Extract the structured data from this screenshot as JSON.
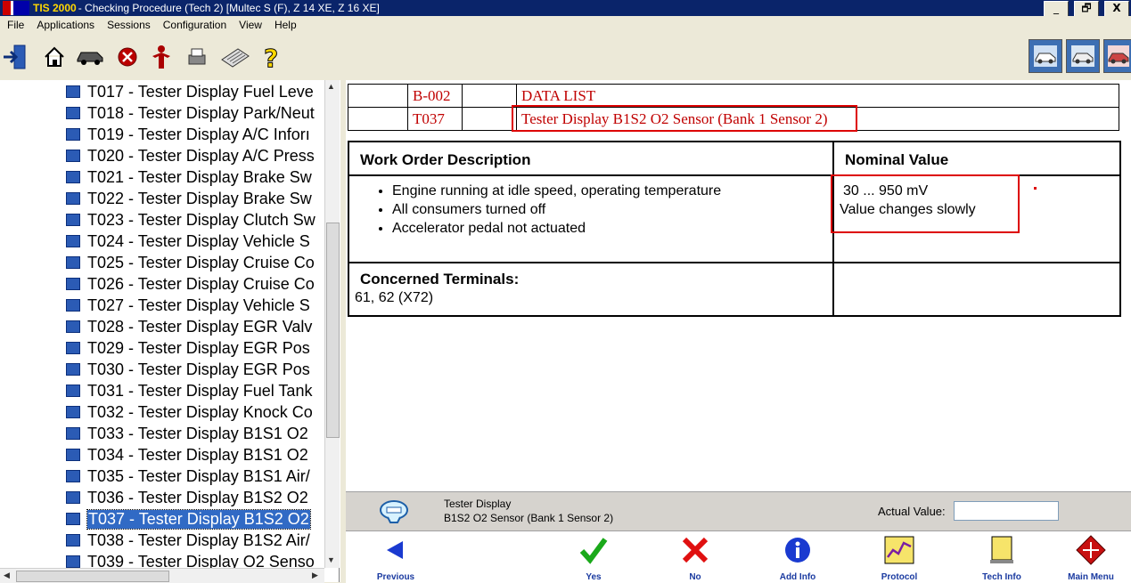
{
  "window": {
    "app_name": "TIS 2000",
    "title": " - Checking Procedure (Tech 2) [Multec S (F), Z 14 XE, Z 16 XE]",
    "buttons": [
      "_",
      "🗗",
      "X"
    ]
  },
  "menu": [
    "File",
    "Applications",
    "Sessions",
    "Configuration",
    "View",
    "Help"
  ],
  "toolbar_icons": [
    "exit-icon",
    "home-icon",
    "vehicle-icon",
    "stop-icon",
    "person-icon",
    "print-icon",
    "keyboard-icon",
    "help-icon"
  ],
  "toolbar_right_icons": [
    "vehicle-diagnostics-icon",
    "vehicle-selection-icon",
    "vehicle-service-icon"
  ],
  "tree": {
    "items": [
      "T017 - Tester Display Fuel Leve",
      "T018 - Tester Display Park/Neut",
      "T019 - Tester Display A/C Inforı",
      "T020 - Tester Display A/C Press",
      "T021 - Tester Display Brake Sw",
      "T022 - Tester Display Brake Sw",
      "T023 - Tester Display Clutch Sw",
      "T024 - Tester Display Vehicle S",
      "T025 - Tester Display Cruise Co",
      "T026 - Tester Display Cruise Co",
      "T027 - Tester Display Vehicle S",
      "T028 - Tester Display EGR Valv",
      "T029 - Tester Display EGR Pos",
      "T030 - Tester Display EGR Pos",
      "T031 - Tester Display Fuel Tank",
      "T032 - Tester Display Knock Co",
      "T033 - Tester Display B1S1 O2",
      "T034 - Tester Display B1S1 O2",
      "T035 - Tester Display B1S1 Air/",
      "T036 - Tester Display B1S2 O2",
      "T037 - Tester Display B1S2 O2",
      "T038 - Tester Display B1S2 Air/",
      "T039 - Tester Display O2 Senso"
    ],
    "selected_index": 20
  },
  "header": {
    "row1": {
      "code": "B-002",
      "text": "DATA LIST"
    },
    "row2": {
      "code": "T037",
      "text": "Tester Display B1S2 O2 Sensor (Bank 1 Sensor 2)"
    }
  },
  "work_order": {
    "heading": "Work Order Description",
    "bullets": [
      "Engine running at idle speed, operating temperature",
      "All consumers turned off",
      "Accelerator pedal not actuated"
    ],
    "nominal_heading": "Nominal Value",
    "nominal_value": "30 ... 950 mV",
    "nominal_note": "Value changes slowly",
    "terminals_heading": "Concerned Terminals:",
    "terminals_value": "61, 62 (X72)"
  },
  "info_bar": {
    "icon": "tech2-display-icon",
    "line1": "Tester Display",
    "line2": "B1S2 O2 Sensor (Bank 1 Sensor 2)",
    "actual_value_label": "Actual Value:",
    "actual_value": ""
  },
  "nav": {
    "previous": "Previous",
    "yes": "Yes",
    "no": "No",
    "add_info": "Add Info",
    "protocol": "Protocol",
    "tech_info": "Tech Info",
    "main_menu": "Main Menu"
  },
  "colors": {
    "header_text": "#c00000",
    "highlight_box": "#dd0000",
    "selection": "#316ac5",
    "title_bar": "#0a246a",
    "nav_label": "#1a3aa0"
  }
}
